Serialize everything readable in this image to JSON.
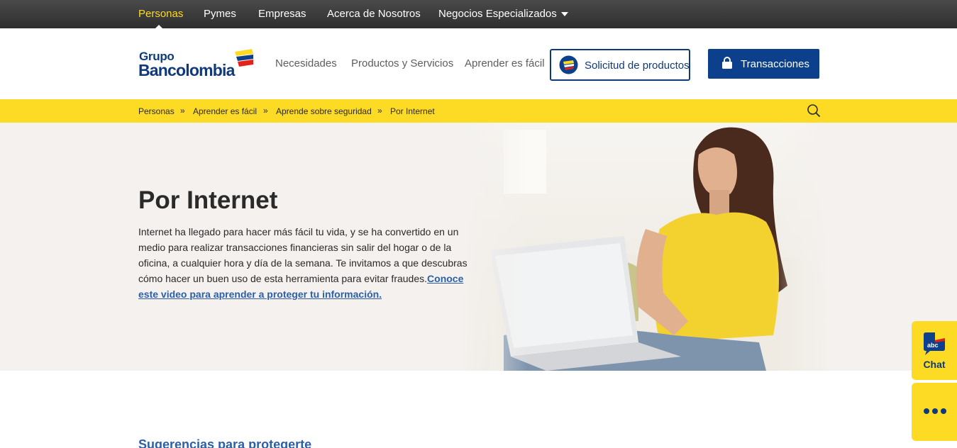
{
  "topnav": {
    "items": [
      {
        "label": "Personas",
        "active": true
      },
      {
        "label": "Pymes"
      },
      {
        "label": "Empresas"
      },
      {
        "label": "Acerca de Nosotros"
      },
      {
        "label": "Negocios Especializados",
        "has_dropdown": true
      }
    ]
  },
  "header": {
    "logo": {
      "line1": "Grupo",
      "line2": "Bancolombia"
    },
    "nav": [
      "Necesidades",
      "Productos y Servicios",
      "Aprender es fácil"
    ],
    "solicitud_button": {
      "label": "Solicitud de productos",
      "icon": "product-request-icon"
    },
    "transacciones_button": {
      "label": "Transacciones",
      "icon": "lock-icon"
    }
  },
  "breadcrumb": {
    "items": [
      "Personas",
      "Aprender es fácil",
      "Aprende sobre seguridad",
      "Por Internet"
    ],
    "separator": "»",
    "search_icon": "search-icon"
  },
  "hero": {
    "title": "Por Internet",
    "body": "Internet ha llegado para hacer más fácil tu vida, y se ha convertido en un medio para realizar transacciones financieras sin salir del hogar o de la oficina, a cualquier hora y día de la semana. Te invitamos a que descubras cómo hacer un buen uso de esta herramienta para evitar fraudes.",
    "link": "Conoce este video para aprender a proteger tu información."
  },
  "section": {
    "title": "Sugerencias para protegerte"
  },
  "side_widgets": {
    "chat": {
      "label": "Chat",
      "badge": "abc"
    },
    "more_icon": "more-dots-icon"
  },
  "colors": {
    "brand_yellow": "#fdda24",
    "brand_blue": "#0e3a7a",
    "button_blue": "#0c3f8c",
    "link_blue": "#2c5fa8",
    "topbar_dark": "#3a3a3a"
  }
}
